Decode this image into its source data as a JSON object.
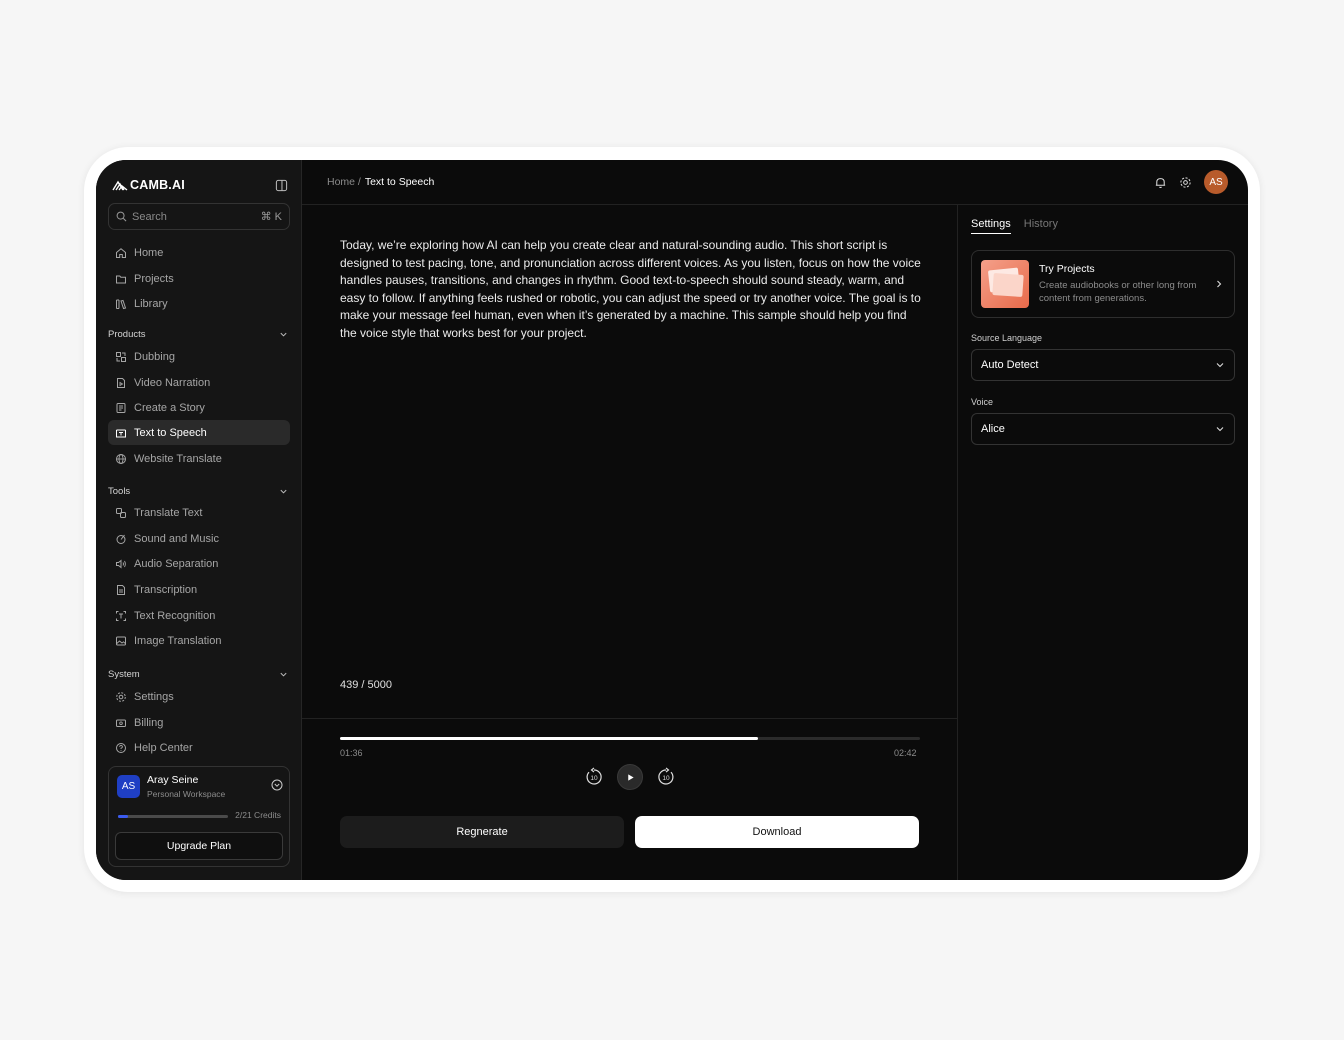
{
  "app": {
    "logo_text": "CAMB.AI"
  },
  "search": {
    "placeholder": "Search",
    "shortcut": "⌘ K"
  },
  "nav": {
    "main": [
      {
        "label": "Home",
        "icon": "home-icon"
      },
      {
        "label": "Projects",
        "icon": "folder-icon"
      },
      {
        "label": "Library",
        "icon": "library-icon"
      }
    ],
    "products_heading": "Products",
    "products": [
      {
        "label": "Dubbing",
        "icon": "dubbing-icon"
      },
      {
        "label": "Video Narration",
        "icon": "video-icon"
      },
      {
        "label": "Create a Story",
        "icon": "story-icon"
      },
      {
        "label": "Text to Speech",
        "icon": "tts-icon",
        "active": true
      },
      {
        "label": "Website Translate",
        "icon": "globe-icon"
      }
    ],
    "tools_heading": "Tools",
    "tools": [
      {
        "label": "Translate Text",
        "icon": "translate-icon"
      },
      {
        "label": "Sound and Music",
        "icon": "music-icon"
      },
      {
        "label": "Audio Separation",
        "icon": "speaker-icon"
      },
      {
        "label": "Transcription",
        "icon": "document-icon"
      },
      {
        "label": "Text Recognition",
        "icon": "scan-icon"
      },
      {
        "label": "Image Translation",
        "icon": "image-icon"
      }
    ],
    "system_heading": "System",
    "system": [
      {
        "label": "Settings",
        "icon": "gear-icon"
      },
      {
        "label": "Billing",
        "icon": "billing-icon"
      },
      {
        "label": "Help Center",
        "icon": "help-icon"
      }
    ]
  },
  "account": {
    "initials": "AS",
    "name": "Aray Seine",
    "workspace": "Personal Workspace",
    "credits": "2/21 Credits",
    "credits_fraction": 0.095,
    "upgrade_label": "Upgrade Plan"
  },
  "header": {
    "breadcrumb_home": "Home /",
    "breadcrumb_current": "Text to Speech",
    "user_initials": "AS"
  },
  "editor": {
    "script": "Today, we’re exploring how AI can help you create clear and natural-sounding audio. This short script is designed to test pacing, tone, and pronunciation across different voices. As you listen, focus on how the voice handles pauses, transitions, and changes in rhythm. Good text-to-speech should sound steady, warm, and easy to follow. If anything feels rushed or robotic, you can adjust the speed or try another voice. The goal is to make your message feel human, even when it’s generated by a machine. This sample should help you find the voice style that works best for your project.",
    "char_count": "439 / 5000"
  },
  "player": {
    "current_time": "01:36",
    "total_time": "02:42",
    "progress_fraction": 0.72,
    "skip_back_label": "10",
    "skip_forward_label": "10"
  },
  "actions": {
    "regenerate_label": "Regnerate",
    "download_label": "Download"
  },
  "panel": {
    "tabs": [
      "Settings",
      "History"
    ],
    "promo": {
      "title": "Try Projects",
      "description": "Create audiobooks or other long from content from generations."
    },
    "source_language_label": "Source Language",
    "source_language_value": "Auto Detect",
    "voice_label": "Voice",
    "voice_value": "Alice"
  },
  "colors": {
    "accent_blue": "#3b5bf0",
    "avatar_orange": "#b85b2b",
    "background": "#0b0b0b"
  }
}
